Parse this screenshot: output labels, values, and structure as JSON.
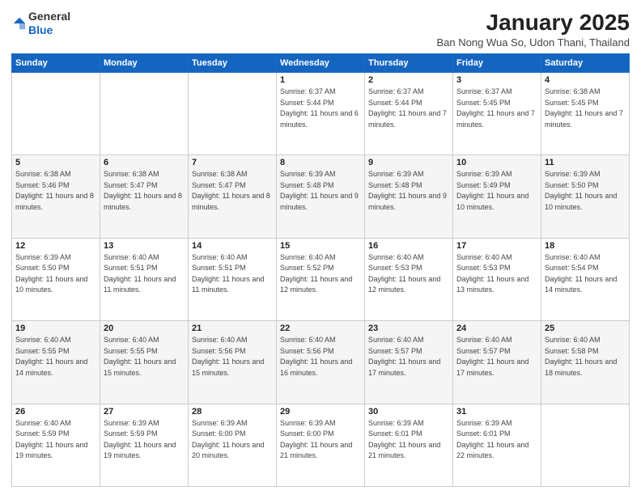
{
  "logo": {
    "general": "General",
    "blue": "Blue"
  },
  "header": {
    "month": "January 2025",
    "location": "Ban Nong Wua So, Udon Thani, Thailand"
  },
  "weekdays": [
    "Sunday",
    "Monday",
    "Tuesday",
    "Wednesday",
    "Thursday",
    "Friday",
    "Saturday"
  ],
  "weeks": [
    [
      {
        "day": "",
        "info": ""
      },
      {
        "day": "",
        "info": ""
      },
      {
        "day": "",
        "info": ""
      },
      {
        "day": "1",
        "info": "Sunrise: 6:37 AM\nSunset: 5:44 PM\nDaylight: 11 hours and 6 minutes."
      },
      {
        "day": "2",
        "info": "Sunrise: 6:37 AM\nSunset: 5:44 PM\nDaylight: 11 hours and 7 minutes."
      },
      {
        "day": "3",
        "info": "Sunrise: 6:37 AM\nSunset: 5:45 PM\nDaylight: 11 hours and 7 minutes."
      },
      {
        "day": "4",
        "info": "Sunrise: 6:38 AM\nSunset: 5:45 PM\nDaylight: 11 hours and 7 minutes."
      }
    ],
    [
      {
        "day": "5",
        "info": "Sunrise: 6:38 AM\nSunset: 5:46 PM\nDaylight: 11 hours and 8 minutes."
      },
      {
        "day": "6",
        "info": "Sunrise: 6:38 AM\nSunset: 5:47 PM\nDaylight: 11 hours and 8 minutes."
      },
      {
        "day": "7",
        "info": "Sunrise: 6:38 AM\nSunset: 5:47 PM\nDaylight: 11 hours and 8 minutes."
      },
      {
        "day": "8",
        "info": "Sunrise: 6:39 AM\nSunset: 5:48 PM\nDaylight: 11 hours and 9 minutes."
      },
      {
        "day": "9",
        "info": "Sunrise: 6:39 AM\nSunset: 5:48 PM\nDaylight: 11 hours and 9 minutes."
      },
      {
        "day": "10",
        "info": "Sunrise: 6:39 AM\nSunset: 5:49 PM\nDaylight: 11 hours and 10 minutes."
      },
      {
        "day": "11",
        "info": "Sunrise: 6:39 AM\nSunset: 5:50 PM\nDaylight: 11 hours and 10 minutes."
      }
    ],
    [
      {
        "day": "12",
        "info": "Sunrise: 6:39 AM\nSunset: 5:50 PM\nDaylight: 11 hours and 10 minutes."
      },
      {
        "day": "13",
        "info": "Sunrise: 6:40 AM\nSunset: 5:51 PM\nDaylight: 11 hours and 11 minutes."
      },
      {
        "day": "14",
        "info": "Sunrise: 6:40 AM\nSunset: 5:51 PM\nDaylight: 11 hours and 11 minutes."
      },
      {
        "day": "15",
        "info": "Sunrise: 6:40 AM\nSunset: 5:52 PM\nDaylight: 11 hours and 12 minutes."
      },
      {
        "day": "16",
        "info": "Sunrise: 6:40 AM\nSunset: 5:53 PM\nDaylight: 11 hours and 12 minutes."
      },
      {
        "day": "17",
        "info": "Sunrise: 6:40 AM\nSunset: 5:53 PM\nDaylight: 11 hours and 13 minutes."
      },
      {
        "day": "18",
        "info": "Sunrise: 6:40 AM\nSunset: 5:54 PM\nDaylight: 11 hours and 14 minutes."
      }
    ],
    [
      {
        "day": "19",
        "info": "Sunrise: 6:40 AM\nSunset: 5:55 PM\nDaylight: 11 hours and 14 minutes."
      },
      {
        "day": "20",
        "info": "Sunrise: 6:40 AM\nSunset: 5:55 PM\nDaylight: 11 hours and 15 minutes."
      },
      {
        "day": "21",
        "info": "Sunrise: 6:40 AM\nSunset: 5:56 PM\nDaylight: 11 hours and 15 minutes."
      },
      {
        "day": "22",
        "info": "Sunrise: 6:40 AM\nSunset: 5:56 PM\nDaylight: 11 hours and 16 minutes."
      },
      {
        "day": "23",
        "info": "Sunrise: 6:40 AM\nSunset: 5:57 PM\nDaylight: 11 hours and 17 minutes."
      },
      {
        "day": "24",
        "info": "Sunrise: 6:40 AM\nSunset: 5:57 PM\nDaylight: 11 hours and 17 minutes."
      },
      {
        "day": "25",
        "info": "Sunrise: 6:40 AM\nSunset: 5:58 PM\nDaylight: 11 hours and 18 minutes."
      }
    ],
    [
      {
        "day": "26",
        "info": "Sunrise: 6:40 AM\nSunset: 5:59 PM\nDaylight: 11 hours and 19 minutes."
      },
      {
        "day": "27",
        "info": "Sunrise: 6:39 AM\nSunset: 5:59 PM\nDaylight: 11 hours and 19 minutes."
      },
      {
        "day": "28",
        "info": "Sunrise: 6:39 AM\nSunset: 6:00 PM\nDaylight: 11 hours and 20 minutes."
      },
      {
        "day": "29",
        "info": "Sunrise: 6:39 AM\nSunset: 6:00 PM\nDaylight: 11 hours and 21 minutes."
      },
      {
        "day": "30",
        "info": "Sunrise: 6:39 AM\nSunset: 6:01 PM\nDaylight: 11 hours and 21 minutes."
      },
      {
        "day": "31",
        "info": "Sunrise: 6:39 AM\nSunset: 6:01 PM\nDaylight: 11 hours and 22 minutes."
      },
      {
        "day": "",
        "info": ""
      }
    ]
  ]
}
